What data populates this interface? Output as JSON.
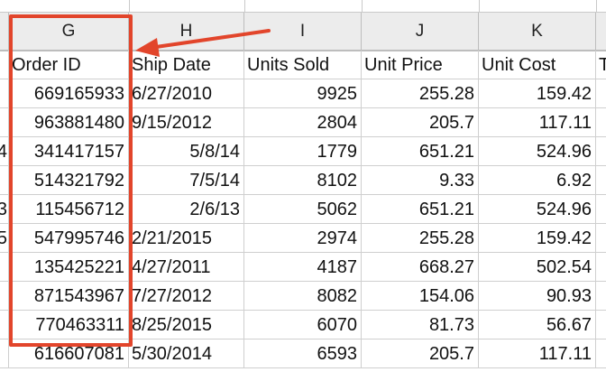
{
  "annotation": {
    "highlight_color": "#e2452b"
  },
  "sheet": {
    "column_letters": [
      "G",
      "H",
      "I",
      "J",
      "K"
    ],
    "headers": [
      "Order ID",
      "Ship Date",
      "Units Sold",
      "Unit Price",
      "Unit Cost",
      "T"
    ],
    "left_edge_fragments": [
      "",
      "",
      "4",
      "",
      "3",
      "5",
      "",
      "",
      "",
      ""
    ],
    "rows": [
      [
        "669165933",
        "6/27/2010",
        "9925",
        "255.28",
        "159.42"
      ],
      [
        "963881480",
        "9/15/2012",
        "2804",
        "205.7",
        "117.11"
      ],
      [
        "341417157",
        "5/8/14",
        "1779",
        "651.21",
        "524.96"
      ],
      [
        "514321792",
        "7/5/14",
        "8102",
        "9.33",
        "6.92"
      ],
      [
        "115456712",
        "2/6/13",
        "5062",
        "651.21",
        "524.96"
      ],
      [
        "547995746",
        "2/21/2015",
        "2974",
        "255.28",
        "159.42"
      ],
      [
        "135425221",
        "4/27/2011",
        "4187",
        "668.27",
        "502.54"
      ],
      [
        "871543967",
        "7/27/2012",
        "8082",
        "154.06",
        "90.93"
      ],
      [
        "770463311",
        "8/25/2015",
        "6070",
        "81.73",
        "56.67"
      ],
      [
        "616607081",
        "5/30/2014",
        "6593",
        "205.7",
        "117.11"
      ]
    ]
  }
}
